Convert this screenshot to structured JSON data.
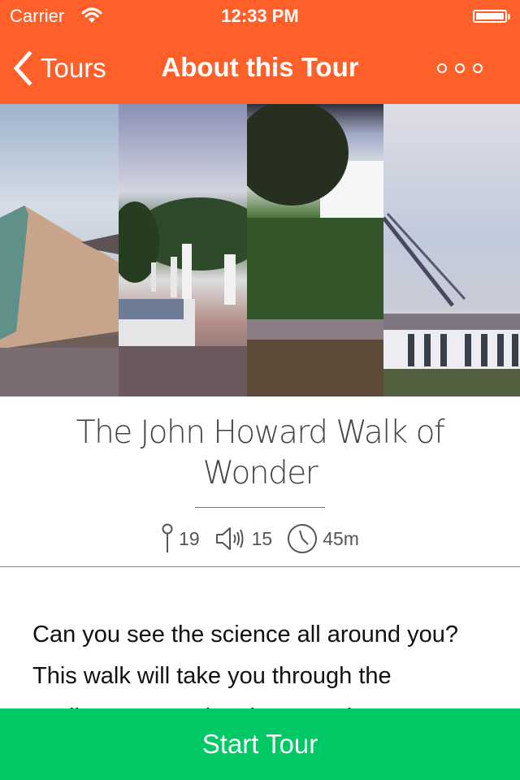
{
  "status_bar": {
    "carrier": "Carrier",
    "time": "12:33 PM",
    "icons": [
      "wifi-icon",
      "battery-icon"
    ]
  },
  "nav": {
    "back_label": "Tours",
    "back_icon": "chevron-left-icon",
    "title": "About this Tour",
    "more_icon": "more-options-icon"
  },
  "hero": {
    "photos": [
      {
        "subject": "Glass and wood wall building with mountain"
      },
      {
        "subject": "Pergola walkway with trees and fountain"
      },
      {
        "subject": "White building on grassy hill"
      },
      {
        "subject": "Parliament House flagpole"
      }
    ]
  },
  "tour": {
    "title": "The John Howard Walk of Wonder",
    "stats": [
      {
        "icon": "map-pin-icon",
        "value": "19"
      },
      {
        "icon": "speaker-icon",
        "value": "15"
      },
      {
        "icon": "clock-icon",
        "value": "45m"
      }
    ],
    "description": "Can you see the science all around you? This walk will take you through the Parliamentary Triangle, up to the"
  },
  "actions": {
    "start_label": "Start Tour"
  },
  "colors": {
    "brand": "#ff5f28",
    "action": "#00c864"
  }
}
